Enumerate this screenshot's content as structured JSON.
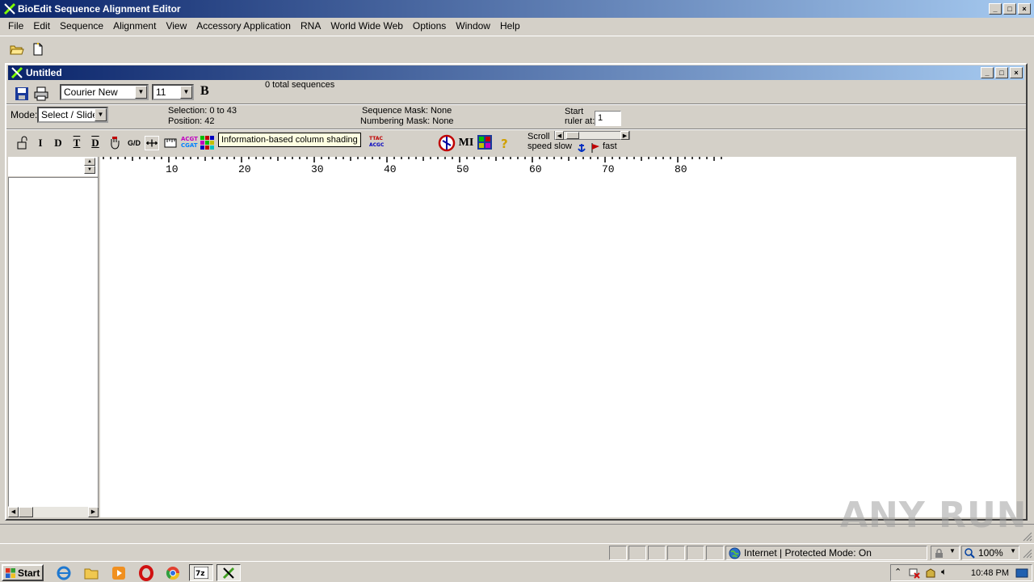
{
  "app": {
    "title": "BioEdit Sequence Alignment Editor",
    "window_buttons": [
      "_",
      "□",
      "×"
    ]
  },
  "menubar": {
    "items": [
      "File",
      "Edit",
      "Sequence",
      "Alignment",
      "View",
      "Accessory Application",
      "RNA",
      "World Wide Web",
      "Options",
      "Window",
      "Help"
    ]
  },
  "document": {
    "title": "Untitled",
    "sequence_count": "0 total sequences",
    "font_name": "Courier New",
    "font_size": "11",
    "bold_label": "B",
    "mode_label": "Mode:",
    "mode_value": "Select / Slide",
    "selection_text": "Selection: 0 to 43",
    "position_text": "Position:  42",
    "sequence_mask": "Sequence Mask: None",
    "numbering_mask": "Numbering Mask: None",
    "start_label_1": "Start",
    "start_label_2": "ruler at:",
    "start_value": "1",
    "scroll_label_1": "Scroll",
    "scroll_label_2": "speed",
    "scroll_slow": "slow",
    "scroll_fast": "fast",
    "mi_label": "MI",
    "tooltip": "Information-based column shading"
  },
  "edit_tools": [
    "I",
    "D",
    "T",
    "D",
    "G/D"
  ],
  "ruler": {
    "labels": [
      "10",
      "20",
      "30",
      "40",
      "50",
      "60",
      "70",
      "80"
    ]
  },
  "ie_status": {
    "zone": "Internet | Protected Mode: On",
    "zoom": "100%"
  },
  "taskbar": {
    "start": "Start",
    "clock": "10:48 PM"
  },
  "watermark": "ANY RUN",
  "colors": {
    "title_start": "#0a246a",
    "title_end": "#a6caf0",
    "face": "#d4d0c8",
    "tooltip": "#ffffe1"
  }
}
